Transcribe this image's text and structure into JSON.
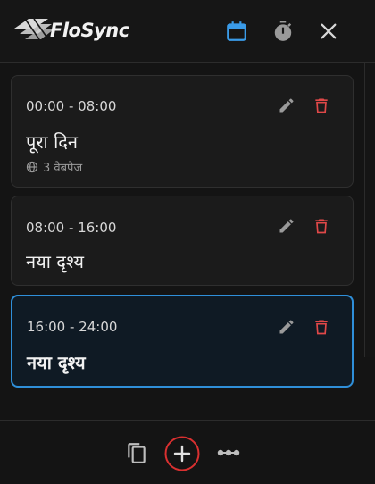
{
  "header": {
    "app_title": "FloSync",
    "icons": [
      "calendar-icon",
      "timer-icon",
      "close-icon"
    ],
    "accent_color": "#3a9be8"
  },
  "cards": [
    {
      "time": "00:00 - 08:00",
      "title": "पूरा दिन",
      "meta": "3 वेबपेज",
      "active": false
    },
    {
      "time": "08:00 - 16:00",
      "title": "नया दृश्य",
      "active": false
    },
    {
      "time": "16:00 - 24:00",
      "title": "नया दृश्य",
      "active": true
    }
  ],
  "colors": {
    "delete": "#e04848",
    "active_border": "#2f8fd9",
    "add_ring": "#d93030"
  },
  "footer": {
    "icons": [
      "copy-icon",
      "add-icon",
      "more-icon"
    ]
  }
}
